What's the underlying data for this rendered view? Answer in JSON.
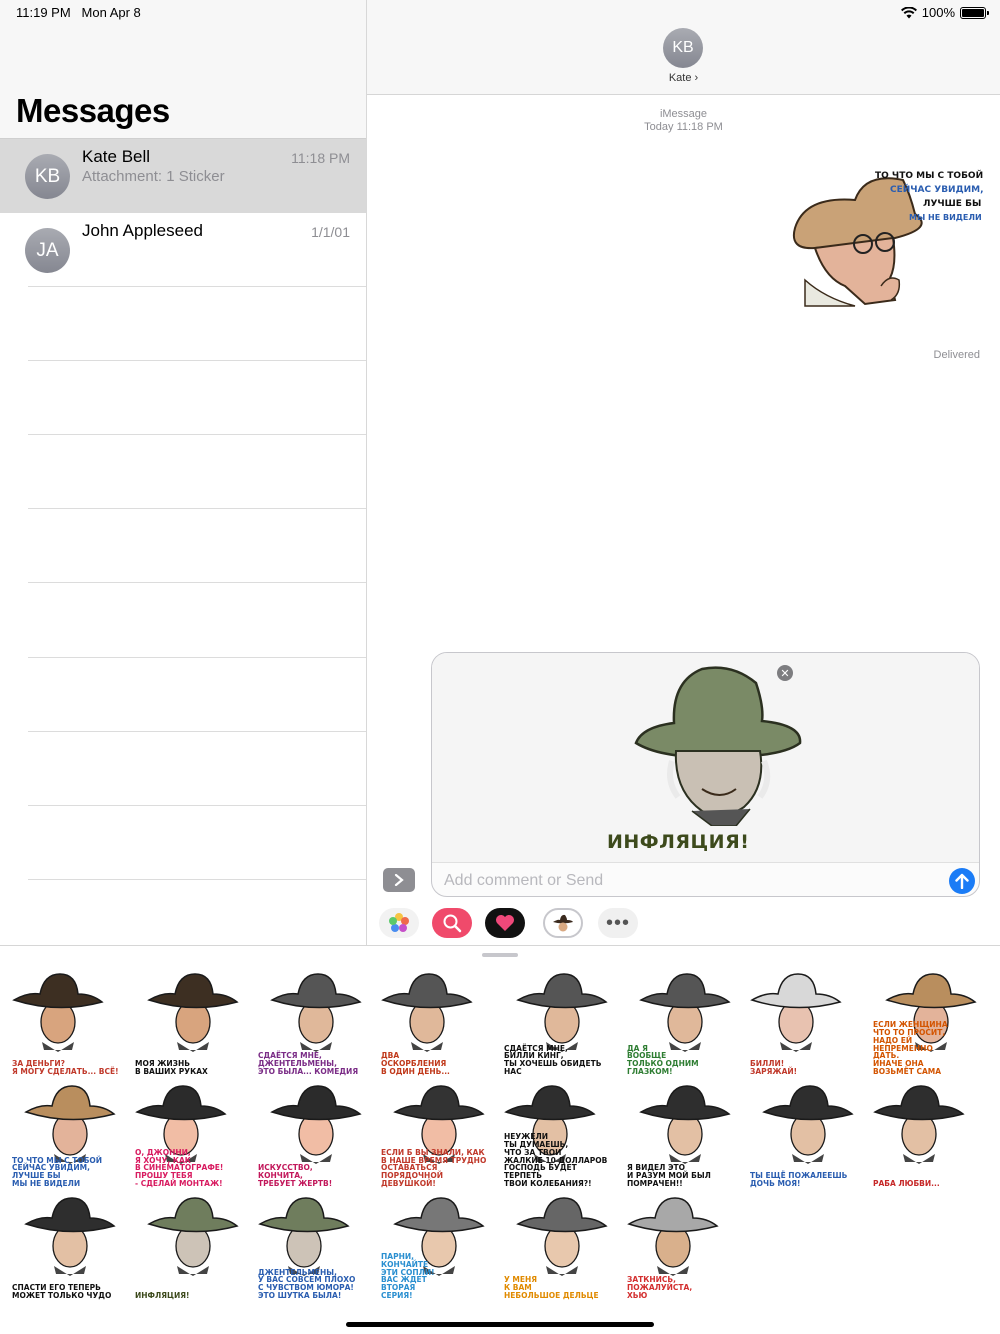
{
  "status": {
    "time": "11:19 PM",
    "date": "Mon Apr 8",
    "battery": "100%"
  },
  "sidebar": {
    "title": "Messages",
    "conversations": [
      {
        "initials": "KB",
        "name": "Kate Bell",
        "preview": "Attachment: 1 Sticker",
        "date": "11:18 PM",
        "selected": true
      },
      {
        "initials": "JA",
        "name": "John Appleseed",
        "preview": "",
        "date": "1/1/01",
        "selected": false
      }
    ]
  },
  "detail": {
    "contact_initials": "KB",
    "contact_name": "Kate ›",
    "service": "iMessage",
    "timestamp": "Today 11:18 PM",
    "delivered": "Delivered",
    "sent_sticker_text": [
      "ТО ЧТО МЫ С ТОБОЙ",
      "СЕЙЧАС УВИДИМ,",
      "ЛУЧШЕ БЫ",
      "МЫ НЕ ВИДЕЛИ"
    ]
  },
  "compose": {
    "preview_caption": "ИНФЛЯЦИЯ!",
    "placeholder": "Add comment or Send"
  },
  "apps": [
    "photos-app",
    "images-search-app",
    "digital-touch-app",
    "sticker-pack-app",
    "more-apps"
  ],
  "stickers": [
    "ЗА ДЕНЬГИ?\nЯ МОГУ СДЕЛАТЬ... ВСЁ!",
    "МОЯ ЖИЗНЬ\nВ ВАШИХ РУКАХ",
    "СДАЁТСЯ МНЕ,\nДЖЕНТЕЛЬМЕНЫ,\nЭТО БЫЛА... КОМЕДИЯ",
    "ДВА\nОСКОРБЛЕНИЯ\nВ ОДИН ДЕНЬ...",
    "СДАЁТСЯ МНЕ,\nБИЛЛИ КИНГ,\nТЫ ХОЧЕШЬ ОБИДЕТЬ НАС",
    "ДА Я\nВООБЩЕ\nТОЛЬКО ОДНИМ ГЛАЗКОМ!",
    "БИЛЛИ!\nЗАРЯЖАЙ!",
    "ЕСЛИ ЖЕНЩИНА\nЧТО ТО ПРОСИТ,\nНАДО ЕЙ\nНЕПРЕМЕННО\nДАТЬ.\nИНАЧЕ ОНА\nВОЗЬМЁТ САМА",
    "ТО ЧТО МЫ С ТОБОЙ\nСЕЙЧАС УВИДИМ,\nЛУЧШЕ БЫ\nМЫ НЕ ВИДЕЛИ",
    "О, ДЖОННИ,\nЯ ХОЧУ, КАК\nВ СИНЕМАТОГРАФЕ!\nПРОШУ ТЕБЯ\n- СДЕЛАЙ МОНТАЖ!",
    "ИСКУССТВО,\nКОНЧИТА,\nТРЕБУЕТ ЖЕРТВ!",
    "ЕСЛИ Б ВЫ ЗНАЛИ, КАК\nВ НАШЕ ВРЕМЯ ТРУДНО\nОСТАВАТЬСЯ ПОРЯДОЧНОЙ\nДЕВУШКОЙ!",
    "НЕУЖЕЛИ\nТЫ ДУМАЕШЬ,\nЧТО ЗА ТВОИ\nЖАЛКИЕ 10 ДОЛЛАРОВ\nГОСПОДЬ БУДЕТ ТЕРПЕТЬ\nТВОИ КОЛЕБАНИЯ?!",
    "Я ВИДЕЛ ЭТО\nИ РАЗУМ МОЙ БЫЛ ПОМРАЧЕН!!",
    "ТЫ ЕЩЁ ПОЖАЛЕЕШЬ\nДОЧЬ МОЯ!",
    "РАБА ЛЮБВИ...",
    "СПАСТИ ЕГО ТЕПЕРЬ\nМОЖЕТ ТОЛЬКО ЧУДО",
    "ИНФЛЯЦИЯ!",
    "ДЖЕНТЕЛЬМЕНЫ,\nУ ВАС СОВСЕМ ПЛОХО\nС ЧУВСТВОМ ЮМОРА!\nЭТО ШУТКА БЫЛА!",
    "ПАРНИ,\nКОНЧАЙТЕ\nЭТИ СОПЛИ!\nВАС ЖДЕТ\nВТОРАЯ\nСЕРИЯ!",
    "У МЕНЯ\nК ВАМ\nНЕБОЛЬШОЕ ДЕЛЬЦЕ",
    "ЗАТКНИСЬ,\nПОЖАЛУЙСТА,\nХЬЮ"
  ]
}
